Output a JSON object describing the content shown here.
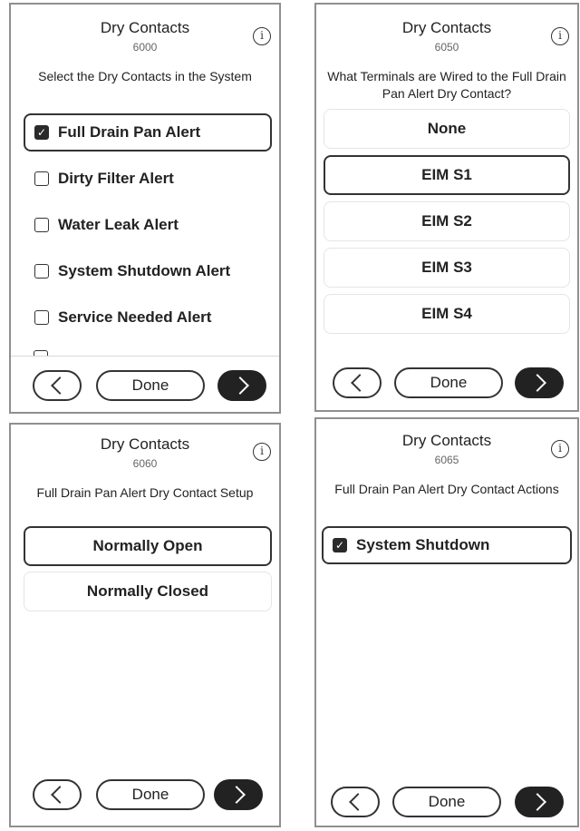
{
  "info_label": "i",
  "screens": [
    {
      "title": "Dry Contacts",
      "code": "6000",
      "subtitle": "Select the Dry Contacts in the System",
      "items": [
        {
          "label": "Full Drain Pan Alert",
          "checked": true
        },
        {
          "label": "Dirty Filter Alert",
          "checked": false
        },
        {
          "label": "Water Leak Alert",
          "checked": false
        },
        {
          "label": "System Shutdown Alert",
          "checked": false
        },
        {
          "label": "Service Needed Alert",
          "checked": false
        }
      ],
      "done_label": "Done"
    },
    {
      "title": "Dry Contacts",
      "code": "6050",
      "subtitle": "What Terminals are Wired to the Full Drain Pan Alert Dry Contact?",
      "options": [
        {
          "label": "None",
          "selected": false
        },
        {
          "label": "EIM S1",
          "selected": true
        },
        {
          "label": "EIM S2",
          "selected": false
        },
        {
          "label": "EIM S3",
          "selected": false
        },
        {
          "label": "EIM S4",
          "selected": false
        }
      ],
      "done_label": "Done"
    },
    {
      "title": "Dry Contacts",
      "code": "6060",
      "subtitle": "Full Drain Pan Alert Dry Contact Setup",
      "options": [
        {
          "label": "Normally Open",
          "selected": true
        },
        {
          "label": "Normally Closed",
          "selected": false
        }
      ],
      "done_label": "Done"
    },
    {
      "title": "Dry Contacts",
      "code": "6065",
      "subtitle": "Full Drain Pan Alert Dry Contact Actions",
      "items": [
        {
          "label": "System Shutdown",
          "checked": true
        }
      ],
      "done_label": "Done"
    }
  ]
}
